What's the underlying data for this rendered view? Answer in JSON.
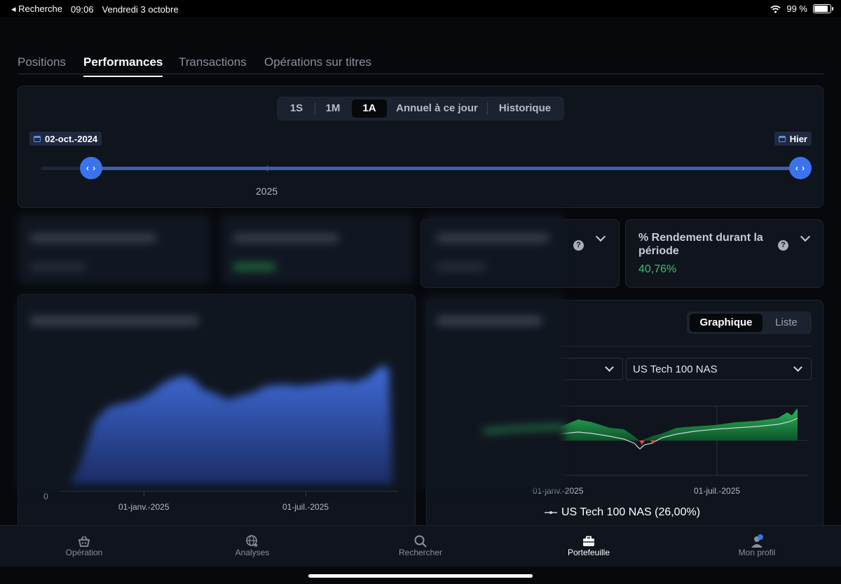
{
  "status": {
    "back": "◂ Recherche",
    "time": "09:06",
    "date": "Vendredi 3 octobre",
    "battery": "99 %"
  },
  "tabs": [
    "Positions",
    "Performances",
    "Transactions",
    "Opérations sur titres"
  ],
  "period": {
    "options": [
      "1S",
      "1M",
      "1A",
      "Annuel à ce jour",
      "Historique"
    ],
    "selected": "1A",
    "start_date": "02-oct.-2024",
    "end_date": "Hier",
    "handle_glyph": "‹ ›",
    "year_marker": "2025"
  },
  "kpi": {
    "title": "% Rendement durant la période",
    "value": "40,76%",
    "help": "?"
  },
  "chart_panel": {
    "view_options": [
      "Graphique",
      "Liste"
    ],
    "selected_view": "Graphique",
    "benchmark": "US Tech 100 NAS",
    "legend": "US Tech 100 NAS (26,00%)",
    "x_labels": [
      "01-janv.-2025",
      "01-juil.-2025"
    ]
  },
  "blurred_chart": {
    "x_labels": [
      "01-janv.-2025",
      "01-juil.-2025"
    ],
    "y_zero": "0"
  },
  "nav": [
    {
      "label": "Opération",
      "icon": "basket-icon"
    },
    {
      "label": "Analyses",
      "icon": "globe-star-icon"
    },
    {
      "label": "Rechercher",
      "icon": "search-icon"
    },
    {
      "label": "Portefeuille",
      "icon": "briefcase-icon"
    },
    {
      "label": "Mon profil",
      "icon": "profile-icon"
    }
  ],
  "colors": {
    "accent": "#3b73ec",
    "positive": "#35c46a",
    "negative": "#e0474c",
    "background": "#06080c",
    "card": "#0f141d"
  }
}
